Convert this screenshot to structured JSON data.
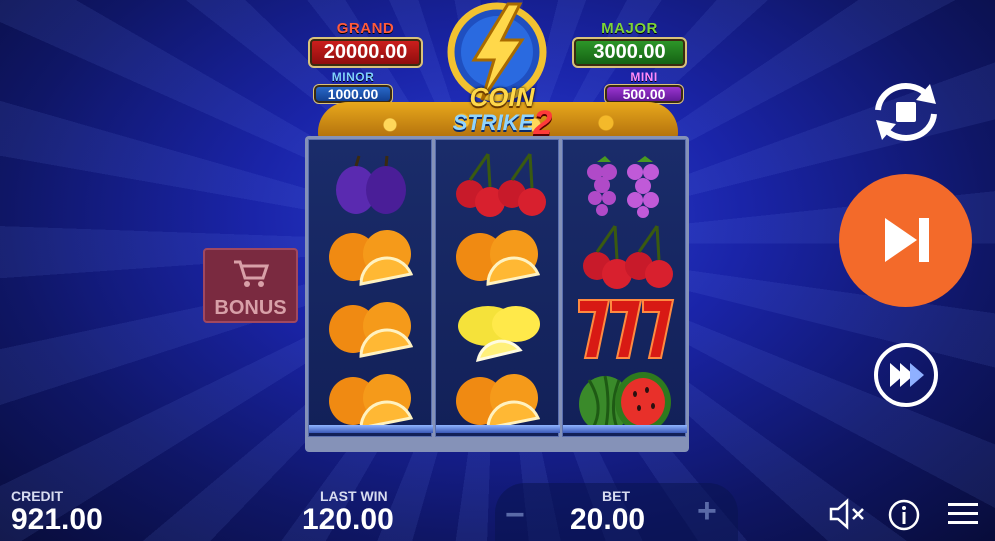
{
  "jackpots": {
    "grand": {
      "label": "GRAND",
      "value": "20000.00"
    },
    "major": {
      "label": "MAJOR",
      "value": "3000.00"
    },
    "minor": {
      "label": "MINOR",
      "value": "1000.00"
    },
    "mini": {
      "label": "MINI",
      "value": "500.00"
    }
  },
  "logo": {
    "line1": "COIN",
    "line2": "STRIKE",
    "number": "2"
  },
  "reels": [
    [
      "plum",
      "orange",
      "orange",
      "orange"
    ],
    [
      "cherry",
      "orange",
      "lemon",
      "orange"
    ],
    [
      "grapes",
      "cherry",
      "seven",
      "watermelon"
    ]
  ],
  "bonus": {
    "label": "BONUS",
    "icon": "cart-icon"
  },
  "controls": {
    "autoplay_icon": "autoplay-stop-icon",
    "spin_icon": "skip-forward-icon",
    "turbo_icon": "fast-forward-icon"
  },
  "bottom": {
    "credit_label": "CREDIT",
    "credit_value": "921.00",
    "last_win_label": "LAST WIN",
    "last_win_value": "120.00",
    "bet_label": "BET",
    "bet_value": "20.00",
    "minus": "−",
    "plus": "+"
  },
  "colors": {
    "spin": "#f36a2a",
    "background": "#1a24a8",
    "grand": "#d0201e",
    "major": "#2f9a2a",
    "minor": "#2c6ed0",
    "mini": "#a33ad8"
  }
}
